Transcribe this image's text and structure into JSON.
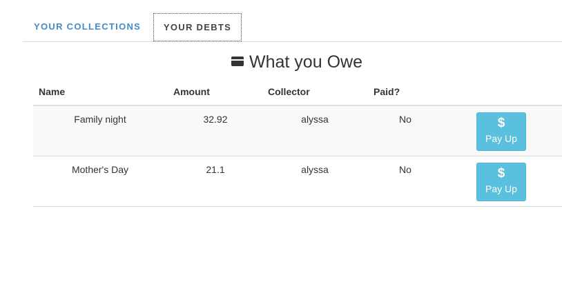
{
  "tabs": [
    {
      "label": "YOUR COLLECTIONS",
      "active": false
    },
    {
      "label": "YOUR DEBTS",
      "active": true
    }
  ],
  "page": {
    "title_icon": "credit-card-icon",
    "title": "What you Owe"
  },
  "table": {
    "headers": {
      "name": "Name",
      "amount": "Amount",
      "collector": "Collector",
      "paid": "Paid?"
    },
    "rows": [
      {
        "name": "Family night",
        "amount": "32.92",
        "collector": "alyssa",
        "paid": "No",
        "button_icon": "$",
        "button_label": "Pay Up"
      },
      {
        "name": "Mother's Day",
        "amount": "21.1",
        "collector": "alyssa",
        "paid": "No",
        "button_icon": "$",
        "button_label": "Pay Up"
      }
    ]
  },
  "colors": {
    "active_tab_link": "#428bca",
    "pay_button": "#5bc0de"
  }
}
